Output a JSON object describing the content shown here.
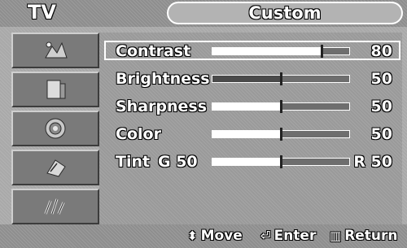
{
  "header": {
    "source": "TV",
    "title": "Custom"
  },
  "sidebar": {
    "items": [
      {
        "icon": "picture-icon"
      },
      {
        "icon": "sound-icon"
      },
      {
        "icon": "channel-icon"
      },
      {
        "icon": "setup-icon"
      },
      {
        "icon": "input-icon"
      }
    ]
  },
  "menu": {
    "rows": [
      {
        "label": "Contrast",
        "value": "80",
        "level": 0.8,
        "selected": true
      },
      {
        "label": "Brightness",
        "value": "50",
        "level": 0.5
      },
      {
        "label": "Sharpness",
        "value": "50",
        "level": 0.5
      },
      {
        "label": "Color",
        "value": "50",
        "level": 0.5
      },
      {
        "label": "Tint",
        "sublabel": "G 50",
        "value": "R 50",
        "level": 0.5
      }
    ]
  },
  "footer": {
    "move": {
      "glyph": "⬍",
      "label": "Move"
    },
    "enter": {
      "glyph": "⏎",
      "label": "Enter"
    },
    "return": {
      "glyph": "▥",
      "label": "Return"
    }
  }
}
